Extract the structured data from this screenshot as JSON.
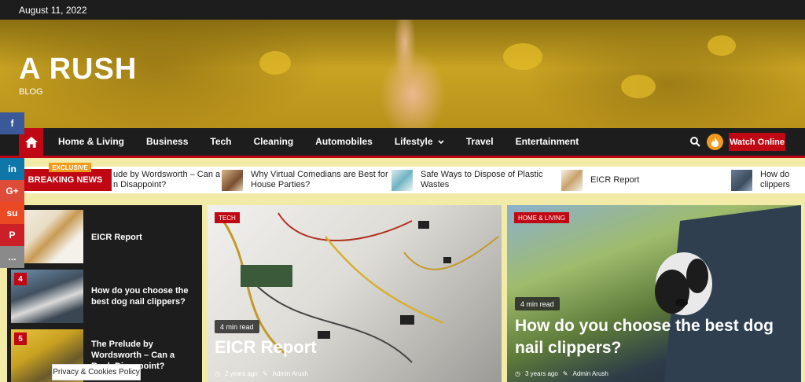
{
  "topbar": {
    "date": "August 11, 2022"
  },
  "site": {
    "title": "A RUSH",
    "tagline": "BLOG"
  },
  "nav": {
    "home_icon": "home-icon",
    "items": [
      "Home & Living",
      "Business",
      "Tech",
      "Cleaning",
      "Automobiles",
      "Lifestyle",
      "Travel",
      "Entertainment"
    ],
    "watch_label": "Watch Online",
    "search_icon": "search-icon",
    "fire_icon": "fire-icon"
  },
  "ticker": {
    "badge": "EXCLUSIVE",
    "label": "BREAKING NEWS",
    "items": [
      "ude by Wordsworth – Can a n Disappoint?",
      "Why Virtual Comedians are Best for House Parties?",
      "Safe Ways to Dispose of Plastic Wastes",
      "EICR Report",
      "How do clippers"
    ]
  },
  "social": [
    "f",
    "in",
    "G+",
    "su",
    "P",
    "..."
  ],
  "list": [
    {
      "num": "",
      "title": "EICR Report"
    },
    {
      "num": "4",
      "title": "How do you choose the best dog nail clippers?"
    },
    {
      "num": "5",
      "title": "The Prelude by Wordsworth – Can a Rock Disappoint?"
    }
  ],
  "cards": [
    {
      "tag": "TECH",
      "read": "4 min read",
      "title": "EICR Report",
      "time": "2 years ago",
      "author": "Admin Arush"
    },
    {
      "tag": "HOME & LIVING",
      "read": "4 min read",
      "title": "How do you choose the best dog nail clippers?",
      "time": "3 years ago",
      "author": "Admin Arush"
    }
  ],
  "privacy": "Privacy & Cookies Policy",
  "colors": {
    "accent": "#c00814",
    "dark": "#1d1d1d",
    "orange": "#f29a1b"
  }
}
